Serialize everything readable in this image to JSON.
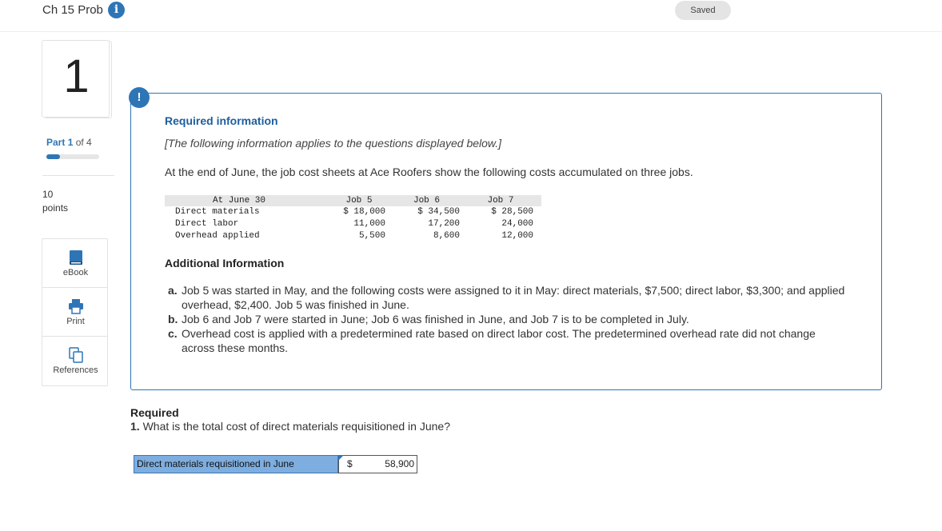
{
  "header": {
    "title": "Ch 15 Prob",
    "info_icon": "i",
    "status": "Saved"
  },
  "sidebar": {
    "question_number": "1",
    "part_word": "Part",
    "part_number": "1",
    "part_of": "of 4",
    "part_progress": 0.25,
    "points_value": "10",
    "points_label": "points",
    "tools": [
      {
        "label": "eBook",
        "icon": "book-icon"
      },
      {
        "label": "Print",
        "icon": "printer-icon"
      },
      {
        "label": "References",
        "icon": "copy-icon"
      }
    ]
  },
  "info": {
    "alert_icon": "!",
    "heading": "Required information",
    "note": "[The following information applies to the questions displayed below.]",
    "intro": "At the end of June, the job cost sheets at Ace Roofers show the following costs accumulated on three jobs.",
    "table": {
      "headers": [
        "At June 30",
        "Job 5",
        "Job 6",
        "Job 7"
      ],
      "rows": [
        [
          "Direct materials",
          "$ 18,000",
          "$ 34,500",
          "$ 28,500"
        ],
        [
          "Direct labor",
          "11,000",
          "17,200",
          "24,000"
        ],
        [
          "Overhead applied",
          "5,500",
          "8,600",
          "12,000"
        ]
      ]
    },
    "additional_title": "Additional Information",
    "additional_items": [
      {
        "letter": "a.",
        "text": "Job 5 was started in May, and the following costs were assigned to it in May: direct materials, $7,500; direct labor, $3,300; and applied overhead, $2,400. Job 5 was finished in June."
      },
      {
        "letter": "b.",
        "text": "Job 6 and Job 7 were started in June; Job 6 was finished in June, and Job 7 is to be completed in July."
      },
      {
        "letter": "c.",
        "text": "Overhead cost is applied with a predetermined rate based on direct labor cost. The predetermined overhead rate did not change across these months."
      }
    ]
  },
  "required": {
    "title": "Required",
    "question_number": "1.",
    "question": "What is the total cost of direct materials requisitioned in June?",
    "answer_label": "Direct materials requisitioned in June",
    "answer_currency": "$",
    "answer_value": "58,900"
  },
  "colors": {
    "accent": "#2e75b6",
    "answer_label_bg": "#7eaee0"
  }
}
